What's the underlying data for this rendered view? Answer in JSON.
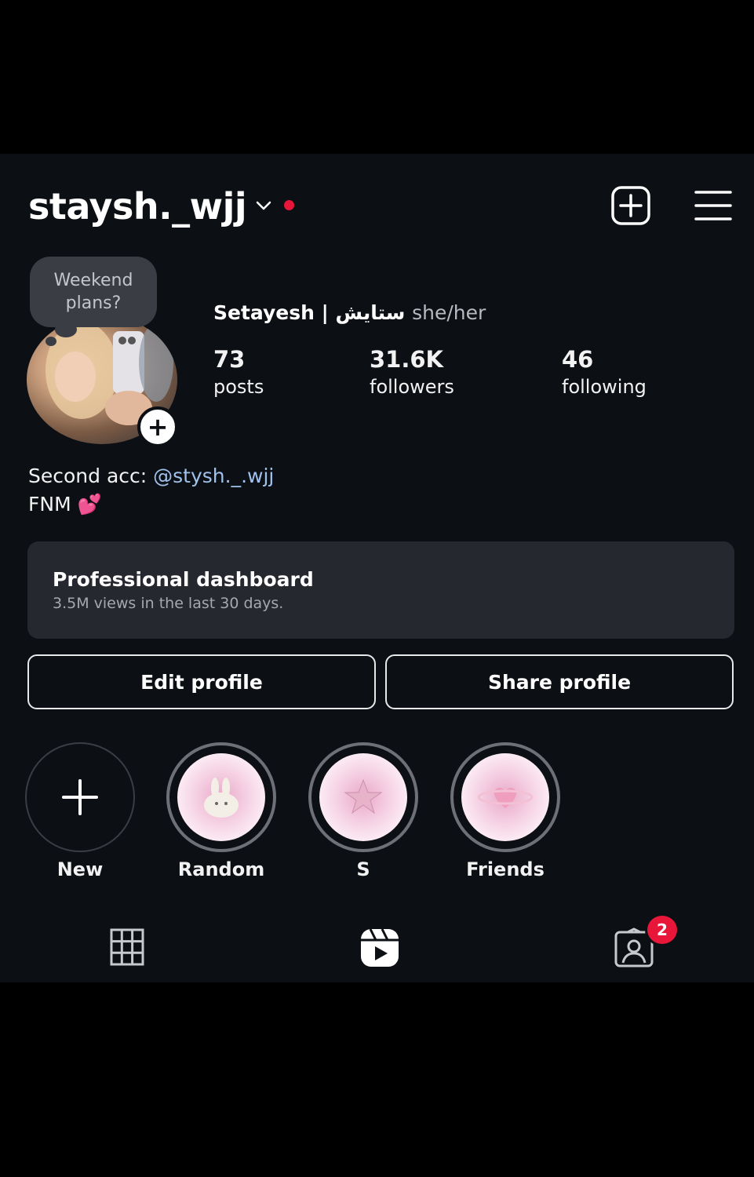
{
  "header": {
    "username": "staysh._wjj",
    "new_post_icon": "plus-square-icon",
    "menu_icon": "hamburger-menu-icon"
  },
  "note": {
    "line1": "Weekend",
    "line2": "plans?"
  },
  "profile": {
    "name": "Setayesh | ستایش",
    "pronouns": "she/her",
    "stats": [
      {
        "value": "73",
        "label": "posts"
      },
      {
        "value": "31.6K",
        "label": "followers"
      },
      {
        "value": "46",
        "label": "following"
      }
    ],
    "bio": {
      "line1_prefix": "Second acc: ",
      "line1_mention": "@stysh._.wjj",
      "line2": "FNM",
      "line2_emoji": "💕"
    }
  },
  "dashboard": {
    "title": "Professional dashboard",
    "subtitle": "3.5M views in the last 30 days."
  },
  "buttons": {
    "edit": "Edit profile",
    "share": "Share profile"
  },
  "highlights": [
    {
      "label": "New",
      "icon": "plus-icon"
    },
    {
      "label": "Random",
      "icon": "bunny-icon"
    },
    {
      "label": "S",
      "icon": "star-icon"
    },
    {
      "label": "Friends",
      "icon": "heart-planet-icon"
    }
  ],
  "tabs": {
    "items": [
      {
        "name": "grid",
        "icon": "grid-icon"
      },
      {
        "name": "reels",
        "icon": "reels-icon"
      },
      {
        "name": "tagged",
        "icon": "tagged-icon"
      }
    ],
    "tagged_badge": "2"
  },
  "colors": {
    "background": "#0c0f14",
    "card": "#25282f",
    "accent_red": "#e8173a",
    "mention_blue": "#9fc2ec"
  }
}
